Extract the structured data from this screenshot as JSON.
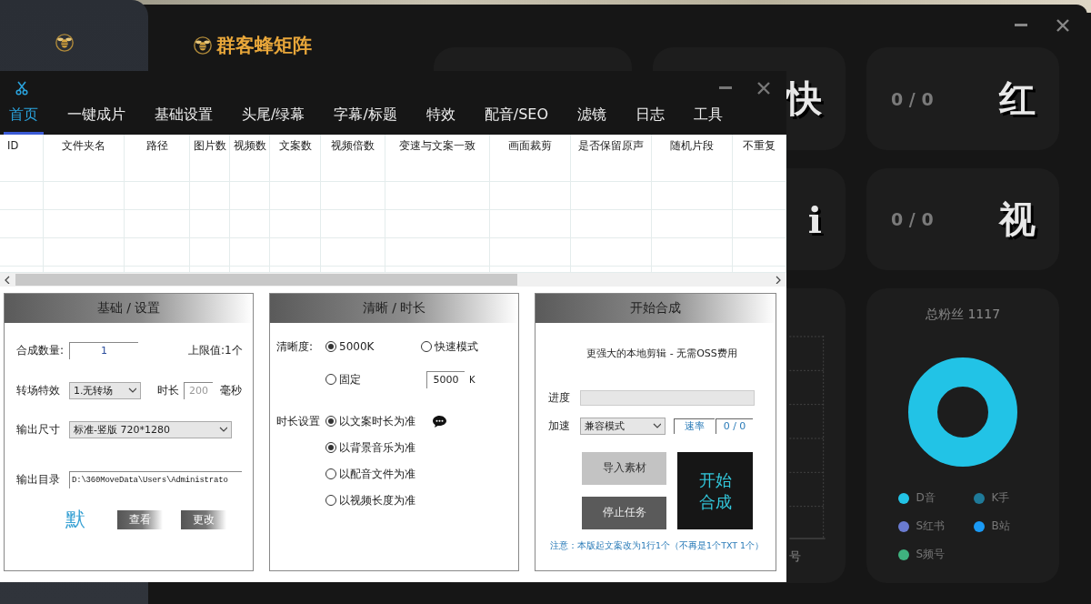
{
  "back_window": {
    "logo": "群客蜂矩阵",
    "stat_cards": [
      {
        "label": "快"
      },
      {
        "count": "0 / 0",
        "label": "红"
      },
      {
        "label": "i"
      },
      {
        "count": "0 / 0",
        "label": "视"
      }
    ],
    "chart_card": {
      "axis_label": "号"
    },
    "fans_card": {
      "title": "总粉丝 1117",
      "legend": [
        {
          "label": "D音",
          "color": "#22c3e6"
        },
        {
          "label": "K手",
          "color": "#1f7a99"
        },
        {
          "label": "S红书",
          "color": "#6a7bd0"
        },
        {
          "label": "B站",
          "color": "#1a9af5"
        },
        {
          "label": "S频号",
          "color": "#3fb27f"
        }
      ]
    }
  },
  "app_window": {
    "tabs": [
      {
        "label": "首页",
        "selected": true
      },
      {
        "label": "一键成片",
        "selected": false
      },
      {
        "label": "基础设置",
        "selected": false
      },
      {
        "label": "头尾/绿幕",
        "selected": false
      },
      {
        "label": "字幕/标题",
        "selected": false
      },
      {
        "label": "特效",
        "selected": false
      },
      {
        "label": "配音/SEO",
        "selected": false
      },
      {
        "label": "滤镜",
        "selected": false
      },
      {
        "label": "日志",
        "selected": false
      },
      {
        "label": "工具",
        "selected": false
      }
    ],
    "table": {
      "columns": [
        "ID",
        "文件夹名",
        "路径",
        "图片数",
        "视频数",
        "文案数",
        "视频倍数",
        "变速与文案一致",
        "画面裁剪",
        "是否保留原声",
        "随机片段",
        "不重复"
      ]
    },
    "basic_panel": {
      "title": "基础 / 设置",
      "count_label": "合成数量:",
      "count_value": "1",
      "limit": "上限值:1个",
      "transition_label": "转场特效",
      "transition_value": "1.无转场",
      "duration_label": "时长",
      "duration_value": "200",
      "duration_unit": "毫秒",
      "size_label": "输出尺寸",
      "size_value": "标准-竖版 720*1280",
      "dir_label": "输出目录",
      "dir_value": "D:\\360MoveData\\Users\\Administrato",
      "default_mark": "默",
      "buttons": [
        "查看",
        "更改"
      ]
    },
    "quality_panel": {
      "title": "清晰 / 时长",
      "quality_label": "清晰度:",
      "quality_options": [
        {
          "label": "5000K",
          "selected": true
        },
        {
          "label": "快速模式",
          "selected": false
        },
        {
          "label": "固定",
          "selected": false
        }
      ],
      "bitrate_value": "5000",
      "bitrate_unit": "K",
      "duration_label": "时长设置",
      "duration_options": [
        {
          "label": "以文案时长为准",
          "selected": true
        },
        {
          "label": "以背景音乐为准",
          "selected": true
        },
        {
          "label": "以配音文件为准",
          "selected": false
        },
        {
          "label": "以视频长度为准",
          "selected": false
        }
      ]
    },
    "start_panel": {
      "title": "开始合成",
      "tagline": "更强大的本地剪辑 - 无需OSS费用",
      "progress_label": "进度",
      "progress": {
        "level": 0
      },
      "speed_label": "加速",
      "speed_mode": "兼容模式",
      "rate_label": "速率",
      "rate_value": "0 / 0",
      "buttons": [
        {
          "label": "导入素材",
          "kind": "light"
        },
        {
          "label": "停止任务",
          "kind": "dark"
        },
        {
          "label": "开始合成",
          "kind": "start"
        }
      ],
      "note": "注意：本版起文案改为1行1个（不再是1个TXT 1个）"
    }
  }
}
